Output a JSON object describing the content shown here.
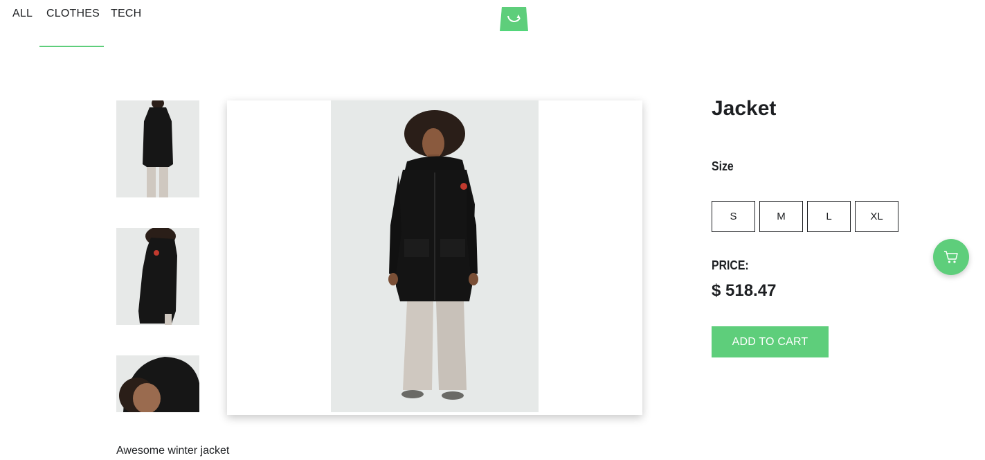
{
  "nav": {
    "tabs": [
      {
        "label": "ALL"
      },
      {
        "label": "CLOTHES",
        "active": true
      },
      {
        "label": "TECH"
      }
    ],
    "accent_color": "#5ece7b"
  },
  "logo": {
    "icon": "shopping-bag-icon"
  },
  "product": {
    "title": "Jacket",
    "size_label": "Size",
    "sizes": [
      "S",
      "M",
      "L",
      "XL"
    ],
    "price_label": "PRICE:",
    "price": "$ 518.47",
    "add_to_cart": "ADD TO CART",
    "description": "Awesome winter jacket"
  },
  "gallery": {
    "thumbnails": [
      "jacket-front-photo",
      "jacket-side-photo",
      "jacket-hood-photo"
    ],
    "main": "jacket-front-photo"
  },
  "floating_cart": {
    "icon": "cart-icon"
  }
}
